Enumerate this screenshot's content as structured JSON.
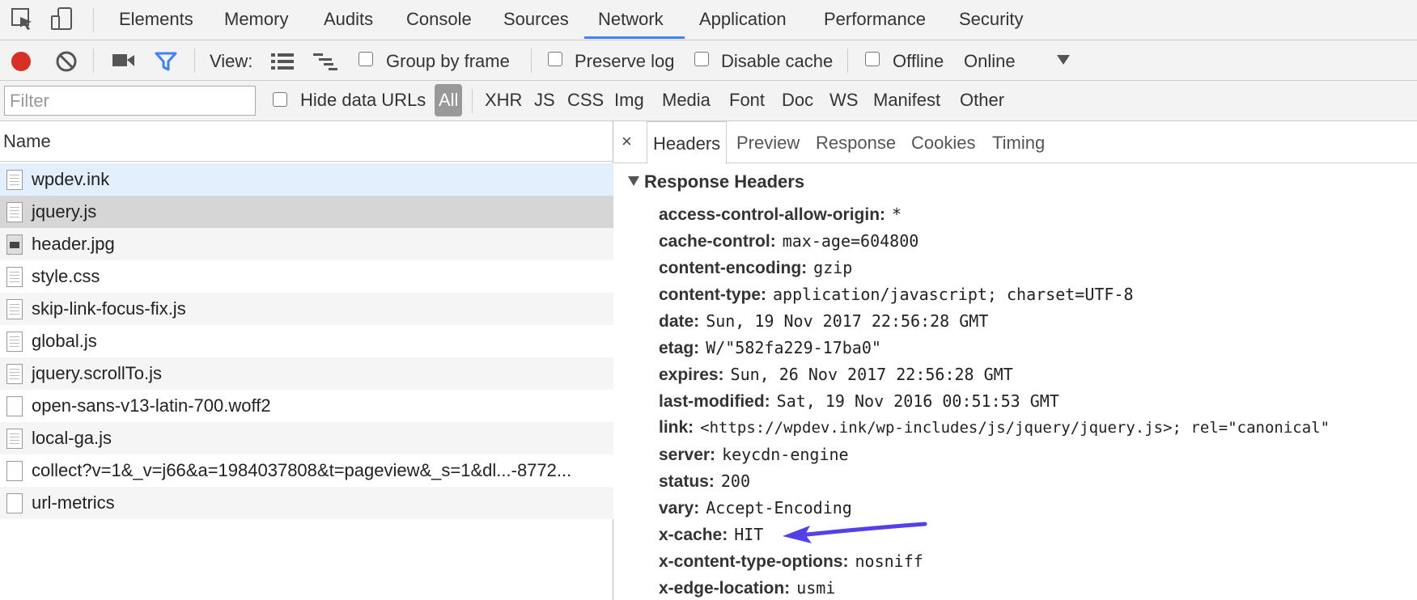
{
  "tabs": [
    "Elements",
    "Memory",
    "Audits",
    "Console",
    "Sources",
    "Network",
    "Application",
    "Performance",
    "Security"
  ],
  "active_tab": "Network",
  "toolbar": {
    "view_label": "View:",
    "group_by_frame": "Group by frame",
    "preserve_log": "Preserve log",
    "disable_cache": "Disable cache",
    "offline": "Offline",
    "throttle_value": "Online",
    "record_color": "#d93025",
    "filter_icon_color": "#3e82f7"
  },
  "filter": {
    "placeholder": "Filter",
    "hide_data_urls": "Hide data URLs",
    "types": [
      "All",
      "XHR",
      "JS",
      "CSS",
      "Img",
      "Media",
      "Font",
      "Doc",
      "WS",
      "Manifest",
      "Other"
    ]
  },
  "requests": {
    "header": "Name",
    "items": [
      {
        "name": "wpdev.ink",
        "icon": "document-icon"
      },
      {
        "name": "jquery.js",
        "icon": "script-icon"
      },
      {
        "name": "header.jpg",
        "icon": "image-icon"
      },
      {
        "name": "style.css",
        "icon": "stylesheet-icon"
      },
      {
        "name": "skip-link-focus-fix.js",
        "icon": "script-icon"
      },
      {
        "name": "global.js",
        "icon": "script-icon"
      },
      {
        "name": "jquery.scrollTo.js",
        "icon": "script-icon"
      },
      {
        "name": "open-sans-v13-latin-700.woff2",
        "icon": "file-icon"
      },
      {
        "name": "local-ga.js",
        "icon": "script-icon"
      },
      {
        "name": "collect?v=1&_v=j66&a=1984037808&t=pageview&_s=1&dl...-8772...",
        "icon": "file-icon"
      },
      {
        "name": "url-metrics",
        "icon": "file-icon"
      }
    ]
  },
  "details": {
    "close": "×",
    "tabs": [
      "Headers",
      "Preview",
      "Response",
      "Cookies",
      "Timing"
    ],
    "active_tab": "Headers",
    "section_title": "Response Headers",
    "headers": [
      {
        "key": "access-control-allow-origin:",
        "value": "*"
      },
      {
        "key": "cache-control:",
        "value": "max-age=604800"
      },
      {
        "key": "content-encoding:",
        "value": "gzip"
      },
      {
        "key": "content-type:",
        "value": "application/javascript; charset=UTF-8"
      },
      {
        "key": "date:",
        "value": "Sun, 19 Nov 2017 22:56:28 GMT"
      },
      {
        "key": "etag:",
        "value": "W/\"582fa229-17ba0\""
      },
      {
        "key": "expires:",
        "value": "Sun, 26 Nov 2017 22:56:28 GMT"
      },
      {
        "key": "last-modified:",
        "value": "Sat, 19 Nov 2016 00:51:53 GMT"
      },
      {
        "key": "link:",
        "value": "<https://wpdev.ink/wp-includes/js/jquery/jquery.js>; rel=\"canonical\""
      },
      {
        "key": "server:",
        "value": "keycdn-engine"
      },
      {
        "key": "status:",
        "value": "200"
      },
      {
        "key": "vary:",
        "value": "Accept-Encoding"
      },
      {
        "key": "x-cache:",
        "value": "HIT"
      },
      {
        "key": "x-content-type-options:",
        "value": "nosniff"
      },
      {
        "key": "x-edge-location:",
        "value": "usmi"
      }
    ],
    "annotation_color": "#5440e8"
  }
}
